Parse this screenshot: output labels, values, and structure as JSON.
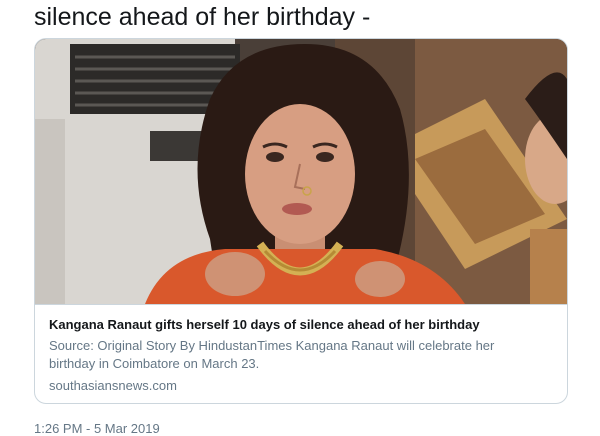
{
  "tweet": {
    "text_tail": "silence ahead of her birthday -",
    "timestamp": "1:26 PM - 5 Mar 2019"
  },
  "card": {
    "image_description": "news-photo",
    "title": "Kangana Ranaut gifts herself 10 days of silence ahead of her birthday",
    "description": "Source: Original Story By HindustanTimes Kangana Ranaut will celebrate her birthday in Coimbatore on March 23.",
    "domain": "southasiansnews.com",
    "domain_icon": "link-icon"
  },
  "colors": {
    "text": "#14171a",
    "secondary": "#657786",
    "border": "#ccd6dd"
  }
}
